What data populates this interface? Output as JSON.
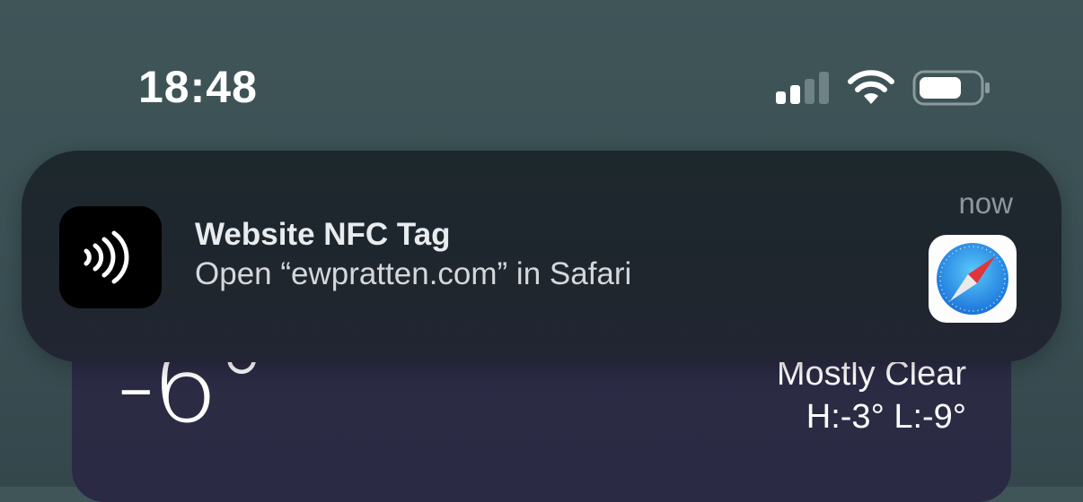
{
  "status_bar": {
    "time": "18:48",
    "icons": [
      "cellular-signal-icon",
      "wifi-icon",
      "battery-icon"
    ]
  },
  "notification": {
    "app_icon": "nfc-icon",
    "title": "Website NFC Tag",
    "body": "Open “ewpratten.com” in Safari",
    "time": "now",
    "attachment_icon": "safari-icon"
  },
  "weather_widget": {
    "temperature": "-6°",
    "condition": "Mostly Clear",
    "high_low": "H:-3° L:-9°"
  },
  "colors": {
    "background": "#3f5558",
    "notification_bg": "#1f262d",
    "widget_bg": "#2c2c45",
    "safari_blue": "#1e88e5"
  }
}
